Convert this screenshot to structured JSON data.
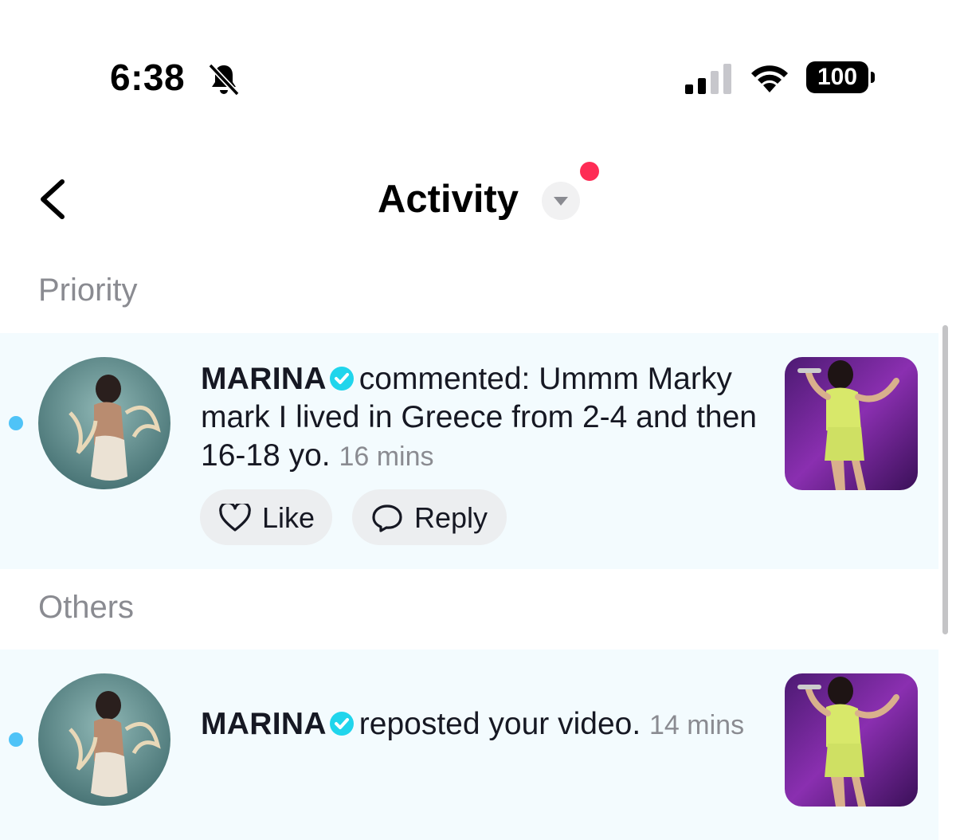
{
  "status_bar": {
    "time": "6:38",
    "battery": "100",
    "icons": [
      "bell-muted-icon",
      "signal-icon",
      "wifi-icon",
      "battery-icon"
    ]
  },
  "header": {
    "title": "Activity",
    "icons": [
      "back-chevron-icon",
      "dropdown-arrow-icon"
    ]
  },
  "sections": {
    "priority": "Priority",
    "others": "Others"
  },
  "priority_item": {
    "user": "MARINA",
    "text": "commented: Ummm Marky mark I lived in Greece from 2-4 and then 16-18 yo.",
    "time": "16 mins",
    "like_label": "Like",
    "reply_label": "Reply"
  },
  "others_item": {
    "user": "MARINA",
    "text": "reposted your video.",
    "time": "14 mins"
  },
  "colors": {
    "accent_red": "#fe2c55",
    "verified_blue": "#20d5ec",
    "unread_blue": "#4fc3f7",
    "row_highlight": "#f3fbfe",
    "secondary_text": "#8a8b91"
  }
}
